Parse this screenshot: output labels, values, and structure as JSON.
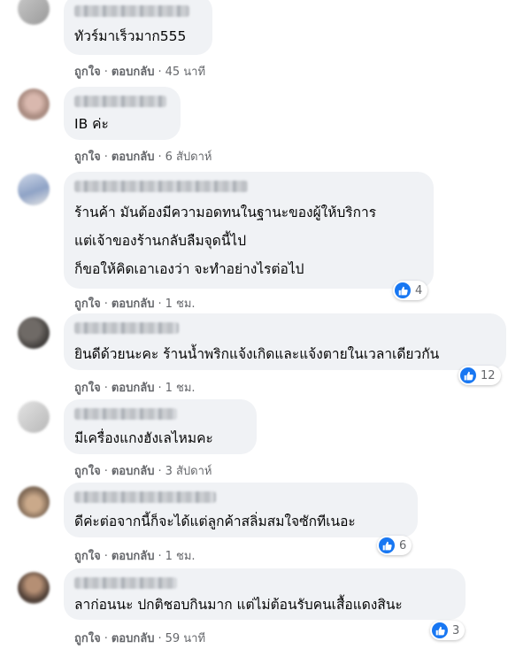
{
  "colors": {
    "bubble": "#f0f2f5",
    "action_text": "#65676b",
    "like_blue": "#1877f2"
  },
  "icons": {
    "reaction": "like-thumb-icon"
  },
  "comments": [
    {
      "lines": [
        "ทัวร์มาเร็วมาก555"
      ],
      "like": "ถูกใจ",
      "reply": "ตอบกลับ",
      "time": "45 นาที"
    },
    {
      "lines": [
        "IB ค่ะ"
      ],
      "like": "ถูกใจ",
      "reply": "ตอบกลับ",
      "time": "6 สัปดาห์"
    },
    {
      "lines": [
        "ร้านค้า มันต้องมีความอดทนในฐานะของผู้ให้บริการ",
        "แต่เจ้าของร้านกลับลืมจุดนี้ไป",
        "ก็ขอให้คิดเอาเองว่า จะทำอย่างไรต่อไป"
      ],
      "like": "ถูกใจ",
      "reply": "ตอบกลับ",
      "time": "1 ชม.",
      "reactions": "4"
    },
    {
      "lines": [
        "ยินดีด้วยนะคะ ร้านน้ำพริกแจ้งเกิดและแจ้งตายในเวลาเดียวกัน"
      ],
      "like": "ถูกใจ",
      "reply": "ตอบกลับ",
      "time": "1 ชม.",
      "reactions": "12"
    },
    {
      "lines": [
        "มีเครื่องแกงฮังเลไหมคะ"
      ],
      "like": "ถูกใจ",
      "reply": "ตอบกลับ",
      "time": "3 สัปดาห์"
    },
    {
      "lines": [
        "ดีค่ะต่อจากนี้ก็จะได้แต่ลูกค้าสลิ่มสมใจซักทีเนอะ"
      ],
      "like": "ถูกใจ",
      "reply": "ตอบกลับ",
      "time": "1 ชม.",
      "reactions": "6"
    },
    {
      "lines": [
        "ลาก่อนนะ ปกติชอบกินมาก แต่ไม่ต้อนรับคนเสื้อแดงสินะ"
      ],
      "like": "ถูกใจ",
      "reply": "ตอบกลับ",
      "time": "59 นาที",
      "reactions": "3"
    }
  ]
}
